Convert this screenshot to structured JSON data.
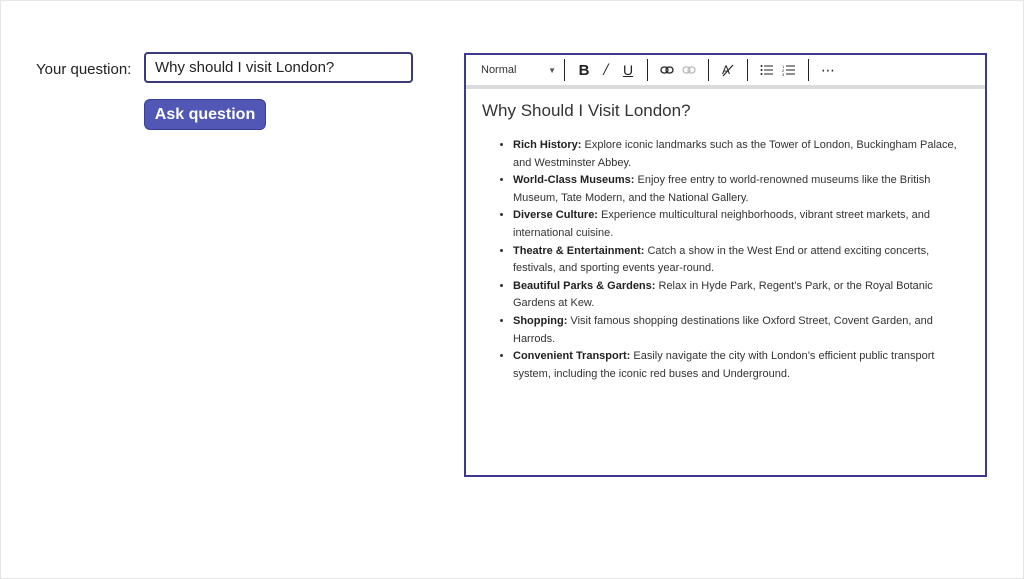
{
  "form": {
    "question_label": "Your question:",
    "question_value": "Why should I visit London?",
    "ask_button": "Ask question"
  },
  "toolbar": {
    "style_select": "Normal",
    "icons": [
      "chevron-down-icon",
      "bold-icon",
      "italic-icon",
      "underline-icon",
      "link-icon",
      "unlink-icon",
      "clear-format-icon",
      "bullet-list-icon",
      "numbered-list-icon",
      "more-icon"
    ]
  },
  "content": {
    "title": "Why Should I Visit London?",
    "points": [
      {
        "heading": "Rich History:",
        "text": " Explore iconic landmarks such as the Tower of London, Buckingham Palace, and Westminster Abbey."
      },
      {
        "heading": "World-Class Museums:",
        "text": " Enjoy free entry to world-renowned museums like the British Museum, Tate Modern, and the National Gallery."
      },
      {
        "heading": "Diverse Culture:",
        "text": " Experience multicultural neighborhoods, vibrant street markets, and international cuisine."
      },
      {
        "heading": "Theatre & Entertainment:",
        "text": " Catch a show in the West End or attend exciting concerts, festivals, and sporting events year-round."
      },
      {
        "heading": "Beautiful Parks & Gardens:",
        "text": " Relax in Hyde Park, Regent’s Park, or the Royal Botanic Gardens at Kew."
      },
      {
        "heading": "Shopping:",
        "text": " Visit famous shopping destinations like Oxford Street, Covent Garden, and Harrods."
      },
      {
        "heading": "Convenient Transport:",
        "text": " Easily navigate the city with London’s efficient public transport system, including the iconic red buses and Underground."
      }
    ]
  },
  "colors": {
    "accent": "#5257b6",
    "border": "#3d3a8e"
  }
}
